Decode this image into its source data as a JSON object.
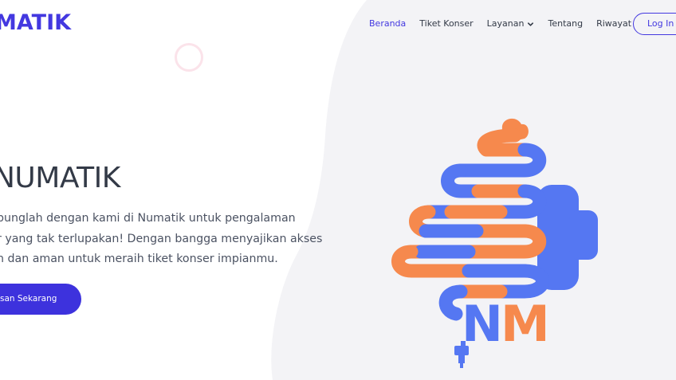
{
  "brand": {
    "name": "MATIK"
  },
  "nav": {
    "items": [
      {
        "label": "Beranda",
        "active": true
      },
      {
        "label": "Tiket Konser",
        "active": false
      },
      {
        "label": "Layanan",
        "active": false,
        "dropdown": true
      },
      {
        "label": "Tentang",
        "active": false
      },
      {
        "label": "Riwayat",
        "active": false
      }
    ],
    "login_label": "Log In"
  },
  "hero": {
    "title": "NUMATIK",
    "description_lines": [
      "bunglah dengan kami di Numatik untuk pengalaman",
      "r yang tak terlupakan! Dengan bangga menyajikan akses",
      "n dan aman untuk meraih tiket konser impianmu."
    ],
    "cta_label": "san Sekarang"
  },
  "logo": {
    "letters": "NM",
    "icon": "intestine-microphone-logo"
  },
  "colors": {
    "accent": "#4338e0",
    "logo_blue": "#5577f2",
    "logo_orange": "#f6894d",
    "blob": "#f3f3f6"
  }
}
